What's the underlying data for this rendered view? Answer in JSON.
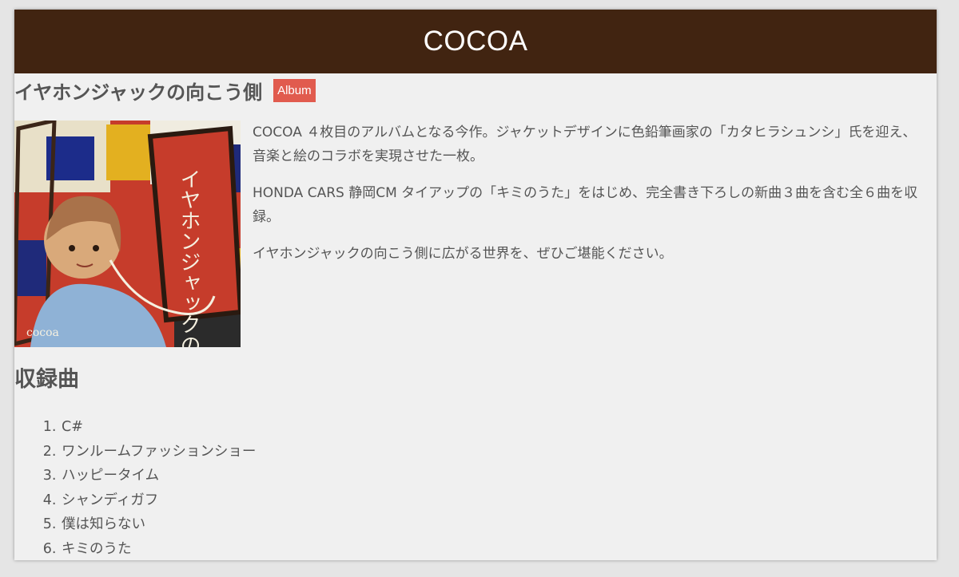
{
  "header": {
    "title": "COCOA"
  },
  "album": {
    "title": "イヤホンジャックの向こう側",
    "badge": "Album",
    "cover_text": "イヤホンジャックの向こう側",
    "cover_logo": "cocoa"
  },
  "description": [
    "COCOA ４枚目のアルバムとなる今作。ジャケットデザインに色鉛筆画家の「カタヒラシュンシ」氏を迎え、音楽と絵のコラボを実現させた一枚。",
    "HONDA CARS 静岡CM タイアップの「キミのうた」をはじめ、完全書き下ろしの新曲３曲を含む全６曲を収録。",
    "イヤホンジャックの向こう側に広がる世界を、ぜひご堪能ください。"
  ],
  "tracks": {
    "heading": "収録曲",
    "items": [
      "C#",
      "ワンルームファッションショー",
      "ハッピータイム",
      "シャンディガフ",
      "僕は知らない",
      "キミのうた"
    ]
  },
  "colors": {
    "header_bg": "#412411",
    "badge_bg": "#e15b4e",
    "page_bg": "#f0f0f0"
  }
}
